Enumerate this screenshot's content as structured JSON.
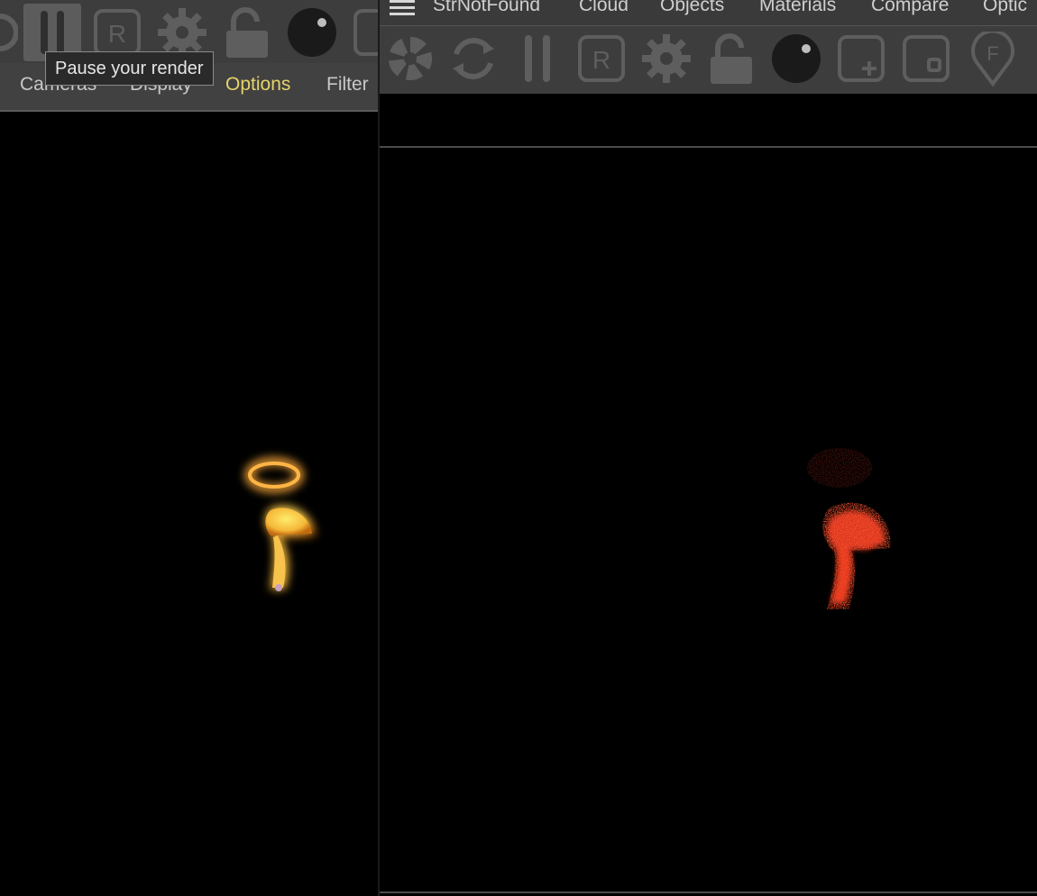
{
  "left_panel": {
    "tabs": [
      {
        "label": "Cameras",
        "active": false
      },
      {
        "label": "Display",
        "active": false
      },
      {
        "label": "Options",
        "active": true
      },
      {
        "label": "Filter",
        "active": false
      }
    ],
    "tooltip": "Pause your render",
    "toolbar_icons": [
      "refresh-icon",
      "pause-icon",
      "render-region-icon",
      "gear-icon",
      "unlock-icon",
      "material-ball-icon",
      "box-icon"
    ]
  },
  "right_panel": {
    "menu": [
      {
        "label": "StrNotFound"
      },
      {
        "label": "Cloud"
      },
      {
        "label": "Objects"
      },
      {
        "label": "Materials"
      },
      {
        "label": "Compare"
      },
      {
        "label": "Optic"
      }
    ],
    "toolbar_icons": [
      "octane-logo-icon",
      "refresh-icon",
      "pause-icon",
      "render-region-icon",
      "gear-icon",
      "unlock-icon",
      "material-ball-icon",
      "add-region-icon",
      "box-icon",
      "focus-pin-icon"
    ]
  },
  "colors": {
    "toolbar_bg": "#3d3d3d",
    "icon_gray": "#5e5e5e",
    "active_tab": "#e6d36a",
    "render_left": "#f5b83a",
    "render_right": "#e23a1f"
  }
}
